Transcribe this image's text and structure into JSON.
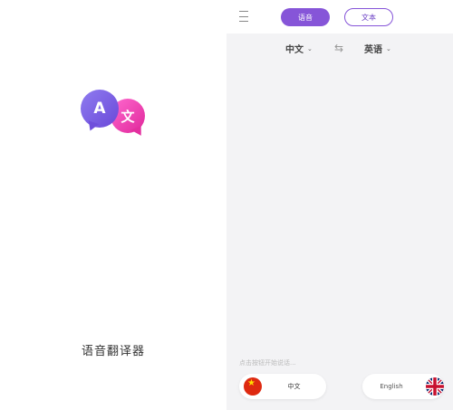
{
  "splash": {
    "logo": {
      "letter_a": "A",
      "letter_wen": "文"
    },
    "app_name": "语音翻译器"
  },
  "translator": {
    "menu_icon": "menu-icon",
    "modes": {
      "voice": "语音",
      "text": "文本",
      "active": "voice"
    },
    "languages": {
      "source": "中文",
      "target": "英语",
      "swap_icon": "swap-icon"
    },
    "hint": "点击按钮开始说话...",
    "buttons": {
      "source_label": "中文",
      "target_label": "English",
      "source_flag": "china-flag-icon",
      "target_flag": "uk-flag-icon"
    }
  },
  "colors": {
    "accent": "#8655d8",
    "bubble_purple": "#7a5ae0",
    "bubble_pink": "#f03fb4",
    "panel_bg": "#f3f3f5"
  }
}
